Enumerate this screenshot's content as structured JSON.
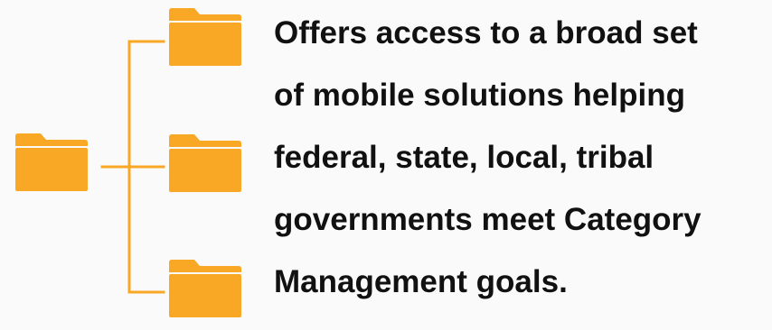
{
  "colors": {
    "folder": "#F9A826",
    "folder_tab": "#F4A020",
    "connector": "#F9A826",
    "text": "#111111",
    "background": "#FAFAFA"
  },
  "tree": {
    "root_icon": "folder-icon",
    "child_icons": [
      "folder-icon",
      "folder-icon",
      "folder-icon"
    ]
  },
  "description": {
    "lines": [
      "Offers access to a broad set",
      "of mobile solutions helping",
      "federal, state, local, tribal",
      "governments meet Category",
      "Management goals."
    ]
  }
}
